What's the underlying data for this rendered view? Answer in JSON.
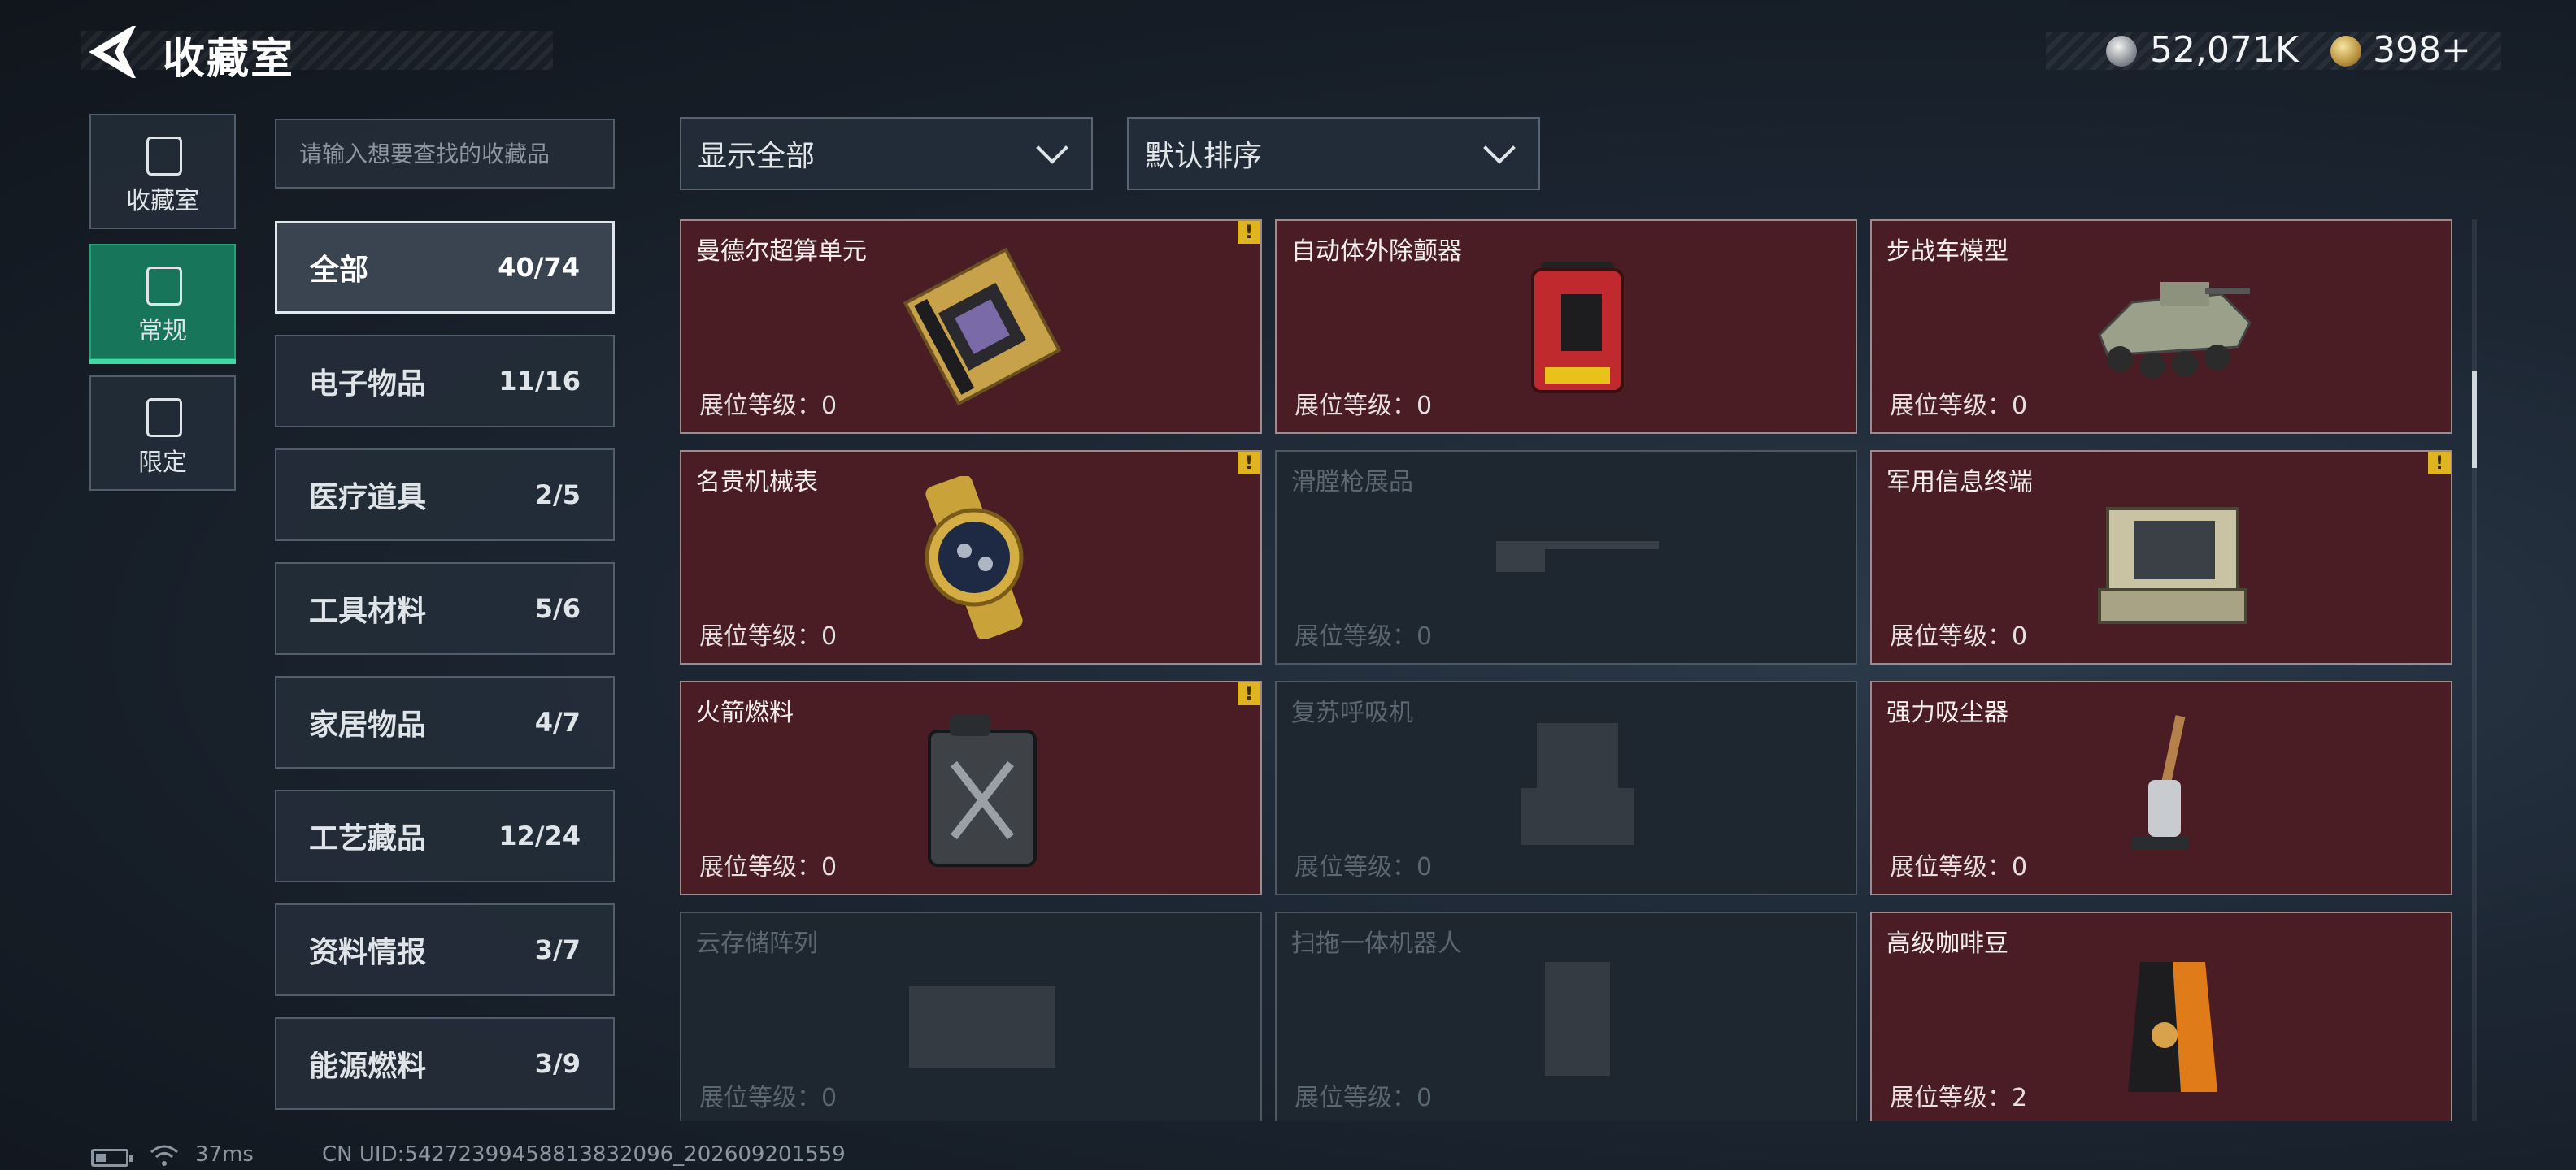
{
  "header": {
    "back_label": "back",
    "title": "收藏室",
    "currency": [
      {
        "icon": "silver-coin-icon",
        "value": "52,071K"
      },
      {
        "icon": "gold-coin-icon",
        "value": "398+"
      }
    ]
  },
  "vertical_nav": [
    {
      "label": "收藏室",
      "icon": "collection-room-icon",
      "active": false
    },
    {
      "label": "常规",
      "icon": "regular-icon",
      "active": true
    },
    {
      "label": "限定",
      "icon": "limited-icon",
      "active": false
    }
  ],
  "search": {
    "placeholder": "请输入想要查找的收藏品",
    "value": ""
  },
  "categories": [
    {
      "label": "全部",
      "count": "40/74",
      "active": true
    },
    {
      "label": "电子物品",
      "count": "11/16",
      "active": false
    },
    {
      "label": "医疗道具",
      "count": "2/5",
      "active": false
    },
    {
      "label": "工具材料",
      "count": "5/6",
      "active": false
    },
    {
      "label": "家居物品",
      "count": "4/7",
      "active": false
    },
    {
      "label": "工艺藏品",
      "count": "12/24",
      "active": false
    },
    {
      "label": "资料情报",
      "count": "3/7",
      "active": false
    },
    {
      "label": "能源燃料",
      "count": "3/9",
      "active": false
    }
  ],
  "filters": {
    "display": {
      "value": "显示全部"
    },
    "sort": {
      "value": "默认排序"
    }
  },
  "level_prefix": "展位等级：",
  "items": [
    {
      "name": "曼德尔超算单元",
      "level": "0",
      "unlocked": true,
      "alert": true,
      "art": "cpu"
    },
    {
      "name": "自动体外除颤器",
      "level": "0",
      "unlocked": true,
      "alert": false,
      "art": "defib"
    },
    {
      "name": "步战车模型",
      "level": "0",
      "unlocked": true,
      "alert": false,
      "art": "tank"
    },
    {
      "name": "名贵机械表",
      "level": "0",
      "unlocked": true,
      "alert": true,
      "art": "watch"
    },
    {
      "name": "滑膛枪展品",
      "level": "0",
      "unlocked": false,
      "alert": false,
      "art": "rifle"
    },
    {
      "name": "军用信息终端",
      "level": "0",
      "unlocked": true,
      "alert": true,
      "art": "terminal"
    },
    {
      "name": "火箭燃料",
      "level": "0",
      "unlocked": true,
      "alert": true,
      "art": "jerrycan"
    },
    {
      "name": "复苏呼吸机",
      "level": "0",
      "unlocked": false,
      "alert": false,
      "art": "ventilator"
    },
    {
      "name": "强力吸尘器",
      "level": "0",
      "unlocked": true,
      "alert": false,
      "art": "vacuum"
    },
    {
      "name": "云存储阵列",
      "level": "0",
      "unlocked": false,
      "alert": false,
      "art": "storage"
    },
    {
      "name": "扫拖一体机器人",
      "level": "0",
      "unlocked": false,
      "alert": false,
      "art": "robot"
    },
    {
      "name": "高级咖啡豆",
      "level": "2",
      "unlocked": true,
      "alert": false,
      "art": "coffee"
    }
  ],
  "footer": {
    "ping": "37ms",
    "uid": "CN UID:54272399458813832096_202609201559"
  },
  "colors": {
    "accent_green": "#17765a",
    "card_unlocked": "#4a1c24",
    "card_locked": "#1e2730",
    "alert_yellow": "#e0b420"
  }
}
